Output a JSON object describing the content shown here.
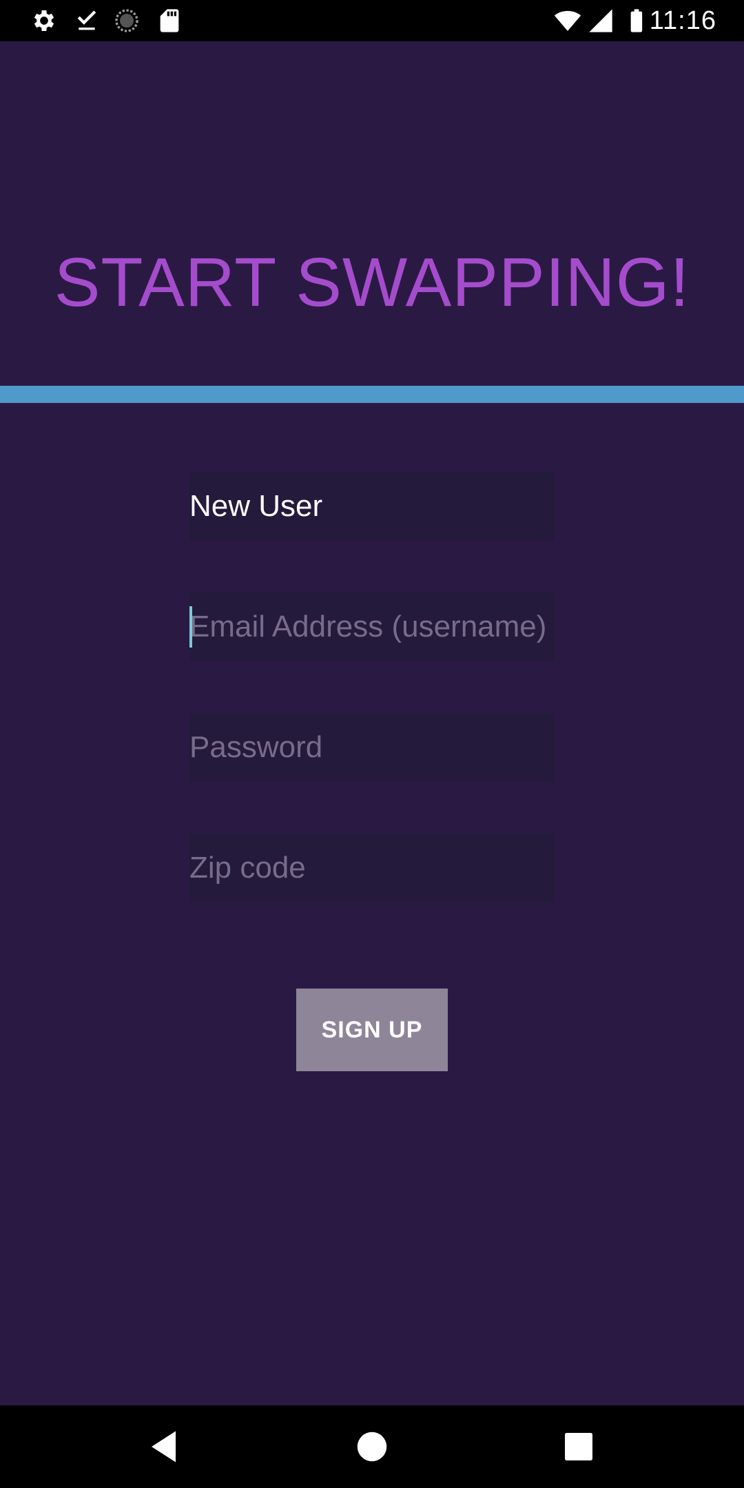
{
  "status_bar": {
    "time": "11:16",
    "left_icons": [
      "gear-icon",
      "download-done-icon",
      "sync-circle-icon",
      "sd-card-icon"
    ],
    "right_icons": [
      "wifi-icon",
      "signal-icon",
      "battery-icon"
    ]
  },
  "hero": {
    "title": "START SWAPPING!"
  },
  "colors": {
    "background": "#2a1a43",
    "title": "#a54ccd",
    "divider": "#4f99cb",
    "field_bg": "#241a3c",
    "placeholder": "#7a6b8a",
    "button_bg": "#8f8599"
  },
  "form": {
    "name_value": "New User",
    "email_placeholder": "Email Address (username)",
    "password_placeholder": "Password",
    "zip_placeholder": "Zip code",
    "signup_label": "SIGN UP"
  },
  "nav": {
    "back": "back-icon",
    "home": "home-icon",
    "recents": "recents-icon"
  }
}
